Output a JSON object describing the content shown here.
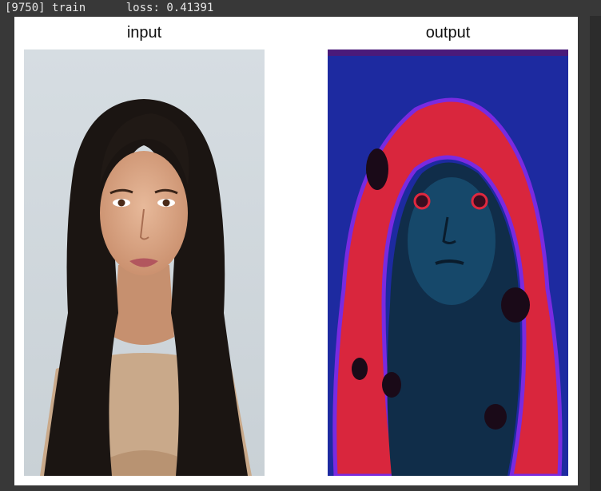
{
  "log": {
    "step": "[9750]",
    "mode": "train",
    "loss_label": "loss:",
    "loss_value": "0.41391"
  },
  "figure": {
    "panels": [
      {
        "title": "input",
        "image": "portrait-photo"
      },
      {
        "title": "output",
        "image": "stylized-portrait"
      }
    ]
  },
  "colors": {
    "background": "#383838",
    "figure_bg": "#ffffff",
    "output_blue": "#1f2fa3",
    "output_red": "#e0283f"
  }
}
